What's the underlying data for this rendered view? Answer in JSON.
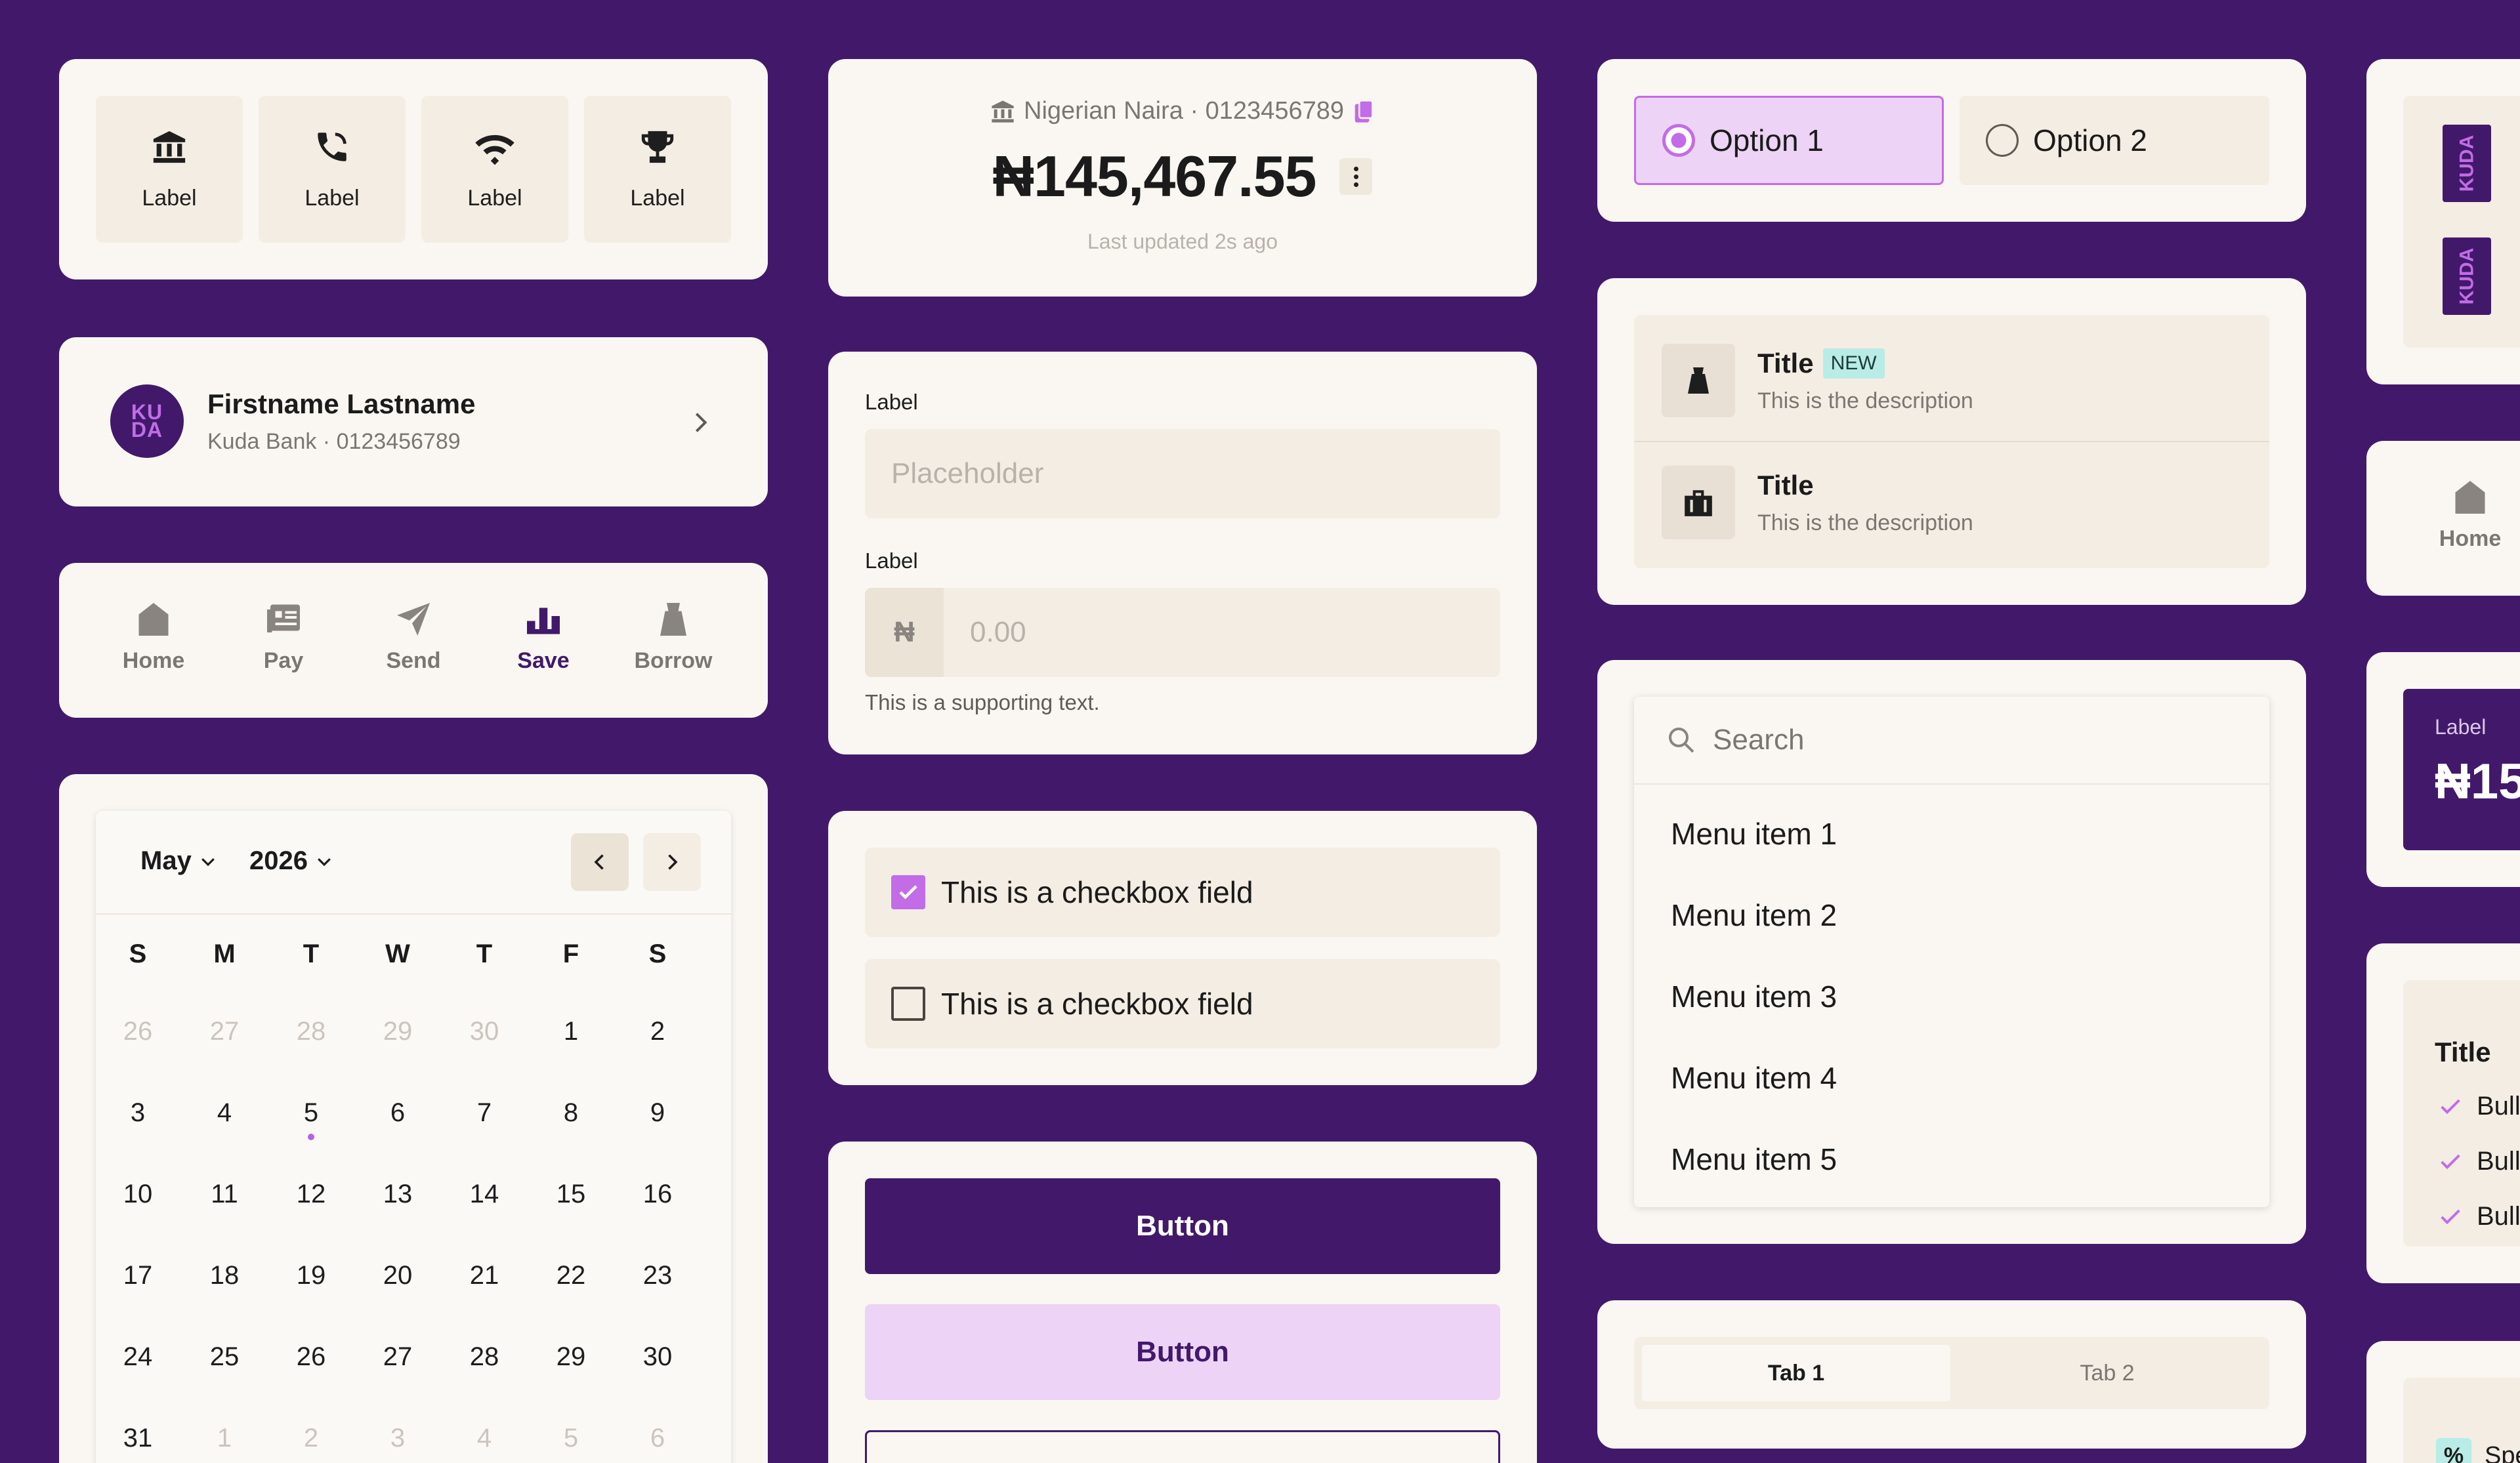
{
  "quick_actions": [
    {
      "label": "Label",
      "icon": "bank-icon"
    },
    {
      "label": "Label",
      "icon": "phone-icon"
    },
    {
      "label": "Label",
      "icon": "wifi-icon"
    },
    {
      "label": "Label",
      "icon": "trophy-icon"
    }
  ],
  "account": {
    "currency_line": "Nigerian Naira · 0123456789",
    "balance": "₦145,467.55",
    "updated": "Last updated 2s ago"
  },
  "radios": {
    "option1": "Option 1",
    "option2": "Option 2",
    "selected": "Option 1"
  },
  "contact": {
    "avatar_text_top": "KU",
    "avatar_text_bottom": "DA",
    "name": "Firstname Lastname",
    "subtitle": "Kuda Bank · 0123456789"
  },
  "bottom_nav": [
    {
      "label": "Home",
      "icon": "home-icon",
      "active": false
    },
    {
      "label": "Pay",
      "icon": "pay-icon",
      "active": false
    },
    {
      "label": "Send",
      "icon": "send-icon",
      "active": false
    },
    {
      "label": "Save",
      "icon": "save-icon",
      "active": true
    },
    {
      "label": "Borrow",
      "icon": "borrow-icon",
      "active": false
    }
  ],
  "form": {
    "label1": "Label",
    "placeholder1": "Placeholder",
    "label2": "Label",
    "currency_symbol": "₦",
    "amount_placeholder": "0.00",
    "supporting_text": "This is a supporting text."
  },
  "list_items": [
    {
      "title": "Title",
      "badge": "NEW",
      "description": "This is the description",
      "icon": "bag-icon"
    },
    {
      "title": "Title",
      "badge": "",
      "description": "This is the description",
      "icon": "briefcase-icon"
    }
  ],
  "checkboxes": [
    {
      "label": "This is a checkbox field",
      "checked": true
    },
    {
      "label": "This is a checkbox field",
      "checked": false
    }
  ],
  "calendar": {
    "month": "May",
    "year": "2026",
    "weekdays": [
      "S",
      "M",
      "T",
      "W",
      "T",
      "F",
      "S"
    ],
    "days": [
      [
        "26",
        "27",
        "28",
        "29",
        "30",
        "1",
        "2"
      ],
      [
        "3",
        "4",
        "5",
        "6",
        "7",
        "8",
        "9"
      ],
      [
        "10",
        "11",
        "12",
        "13",
        "14",
        "15",
        "16"
      ],
      [
        "17",
        "18",
        "19",
        "20",
        "21",
        "22",
        "23"
      ],
      [
        "24",
        "25",
        "26",
        "27",
        "28",
        "29",
        "30"
      ],
      [
        "31",
        "1",
        "2",
        "3",
        "4",
        "5",
        "6"
      ]
    ],
    "today": "5"
  },
  "search_menu": {
    "placeholder": "Search",
    "items": [
      "Menu item 1",
      "Menu item 2",
      "Menu item 3",
      "Menu item 4",
      "Menu item 5"
    ]
  },
  "buttons": {
    "primary": "Button",
    "secondary": "Button"
  },
  "tabs": {
    "tab1": "Tab 1",
    "tab2": "Tab 2",
    "active": "Tab 1"
  },
  "right_column": {
    "logo_text": "KUDA",
    "home_label": "Home",
    "balance_label": "Label",
    "balance_value": "₦15",
    "bullet_title": "Title",
    "bullets": [
      "Bull",
      "Bull",
      "Bull"
    ],
    "chip_text": "Spe"
  },
  "colors": {
    "background": "#42196a",
    "card": "#faf7f2",
    "tile": "#f4ede3",
    "accent": "#c26ce8",
    "accent_soft": "#edd3f6",
    "primary": "#42196a",
    "muted_text": "#7c7672",
    "badge": "#b9ece6"
  }
}
